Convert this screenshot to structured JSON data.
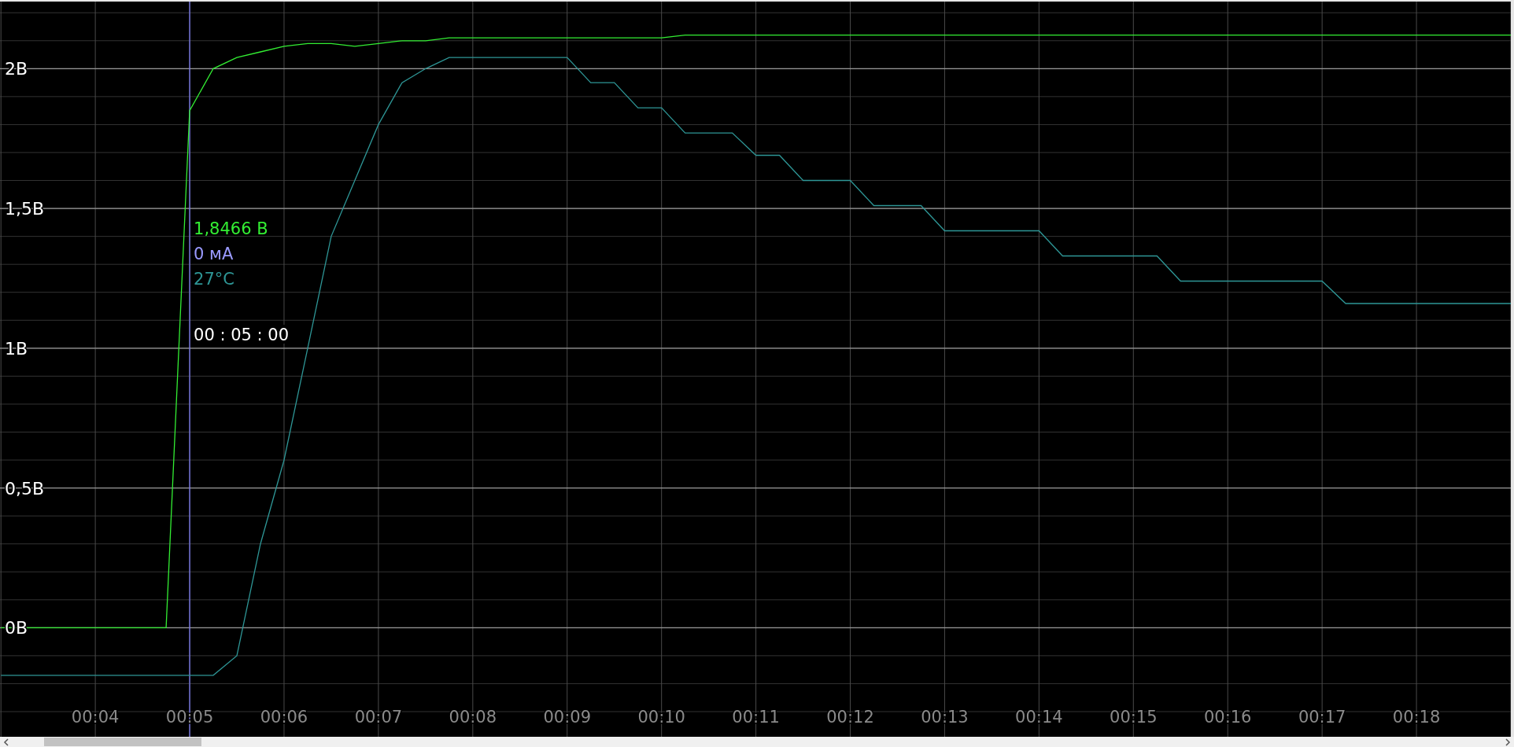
{
  "chart": {
    "chart_data": {
      "type": "line",
      "x": [
        3,
        3.25,
        3.5,
        3.75,
        4,
        4.25,
        4.5,
        4.75,
        5,
        5.25,
        5.5,
        5.75,
        6,
        6.25,
        6.5,
        6.75,
        7,
        7.25,
        7.5,
        7.75,
        8,
        8.25,
        8.5,
        8.75,
        9,
        9.25,
        9.5,
        9.75,
        10,
        10.25,
        10.5,
        10.75,
        11,
        11.25,
        11.5,
        11.75,
        12,
        12.25,
        12.5,
        12.75,
        13,
        13.25,
        13.5,
        13.75,
        14,
        14.25,
        14.5,
        14.75,
        15,
        15.25,
        15.5,
        15.75,
        16,
        16.25,
        16.5,
        16.75,
        17,
        17.25,
        17.5,
        17.75,
        18,
        18.25,
        18.5,
        18.75,
        19
      ],
      "series": [
        {
          "color": "#33ee33",
          "values": [
            0,
            0,
            0,
            0,
            0,
            0,
            0,
            0,
            1.85,
            2.0,
            2.04,
            2.06,
            2.08,
            2.09,
            2.09,
            2.08,
            2.09,
            2.1,
            2.1,
            2.11,
            2.11,
            2.11,
            2.11,
            2.11,
            2.11,
            2.11,
            2.11,
            2.11,
            2.11,
            2.12,
            2.12,
            2.12,
            2.12,
            2.12,
            2.12,
            2.12,
            2.12,
            2.12,
            2.12,
            2.12,
            2.12,
            2.12,
            2.12,
            2.12,
            2.12,
            2.12,
            2.12,
            2.12,
            2.12,
            2.12,
            2.12,
            2.12,
            2.12,
            2.12,
            2.12,
            2.12,
            2.12,
            2.12,
            2.12,
            2.12,
            2.12,
            2.12,
            2.12,
            2.12,
            2.12
          ]
        },
        {
          "color": "#2e9696",
          "values": [
            -0.17,
            -0.17,
            -0.17,
            -0.17,
            -0.17,
            -0.17,
            -0.17,
            -0.17,
            -0.17,
            -0.17,
            -0.1,
            0.3,
            0.6,
            1.0,
            1.4,
            1.6,
            1.8,
            1.95,
            2.0,
            2.04,
            2.04,
            2.04,
            2.04,
            2.04,
            2.04,
            1.95,
            1.95,
            1.86,
            1.86,
            1.77,
            1.77,
            1.77,
            1.69,
            1.69,
            1.6,
            1.6,
            1.6,
            1.51,
            1.51,
            1.51,
            1.42,
            1.42,
            1.42,
            1.42,
            1.42,
            1.33,
            1.33,
            1.33,
            1.33,
            1.33,
            1.24,
            1.24,
            1.24,
            1.24,
            1.24,
            1.24,
            1.24,
            1.16,
            1.16,
            1.16,
            1.16,
            1.16,
            1.16,
            1.16,
            1.16
          ]
        }
      ],
      "xlim": [
        2.99,
        19.0
      ],
      "ylim": [
        -0.39,
        2.24
      ],
      "xticks": [
        {
          "value": 4,
          "label": "00:04"
        },
        {
          "value": 5,
          "label": "00:05"
        },
        {
          "value": 6,
          "label": "00:06"
        },
        {
          "value": 7,
          "label": "00:07"
        },
        {
          "value": 8,
          "label": "00:08"
        },
        {
          "value": 9,
          "label": "00:09"
        },
        {
          "value": 10,
          "label": "00:10"
        },
        {
          "value": 11,
          "label": "00:11"
        },
        {
          "value": 12,
          "label": "00:12"
        },
        {
          "value": 13,
          "label": "00:13"
        },
        {
          "value": 14,
          "label": "00:14"
        },
        {
          "value": 15,
          "label": "00:15"
        },
        {
          "value": 16,
          "label": "00:16"
        },
        {
          "value": 17,
          "label": "00:17"
        },
        {
          "value": 18,
          "label": "00:18"
        }
      ],
      "yticks": [
        {
          "value": 0,
          "label": "0В"
        },
        {
          "value": 0.5,
          "label": "0,5В"
        },
        {
          "value": 1,
          "label": "1В"
        },
        {
          "value": 1.5,
          "label": "1,5В"
        },
        {
          "value": 2,
          "label": "2В"
        }
      ],
      "grid": true,
      "ref_lines": [
        {
          "axis": "x",
          "value": 5,
          "color": "#7a7aee"
        }
      ]
    },
    "cursor": {
      "time": "00 : 05 : 00",
      "readings": [
        {
          "text": "1,8466 В",
          "color": "#33ee33"
        },
        {
          "text": "0 мА",
          "color": "#9a9aff"
        },
        {
          "text": "27°C",
          "color": "#2e9696"
        }
      ]
    }
  }
}
